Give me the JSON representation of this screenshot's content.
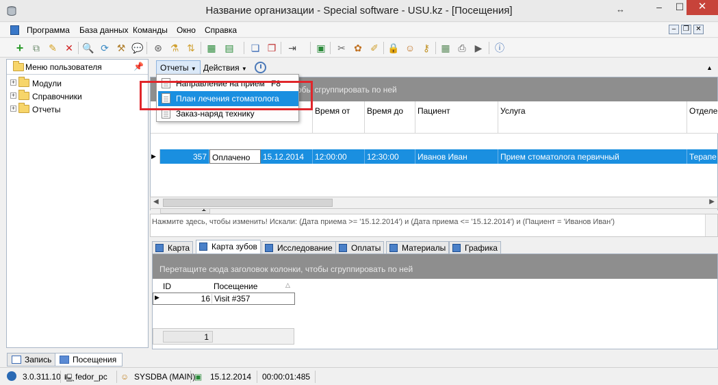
{
  "window": {
    "title": "Название организации - Special software - USU.kz - [Посещения]",
    "controls": {
      "min": "–",
      "max": "☐",
      "close": "✕",
      "resize": "↔"
    }
  },
  "menubar": {
    "items": [
      "Программа",
      "База данных",
      "Команды",
      "Окно",
      "Справка"
    ],
    "mdi": {
      "min": "–",
      "restore": "❐",
      "close": "✕"
    }
  },
  "toolbar": {
    "icons": [
      "add-icon",
      "copy-icon",
      "edit-icon",
      "delete-icon",
      "search-icon",
      "refresh-icon",
      "tools-icon",
      "chat-icon",
      "binoculars-icon",
      "filter-icon",
      "sort-icon",
      "export-excel-icon",
      "import-icon",
      "new-window-icon",
      "close-window-icon",
      "exit-icon",
      "calendar-icon",
      "tools2-icon",
      "paint-icon",
      "note-icon",
      "lock-icon",
      "users-icon",
      "keys-icon",
      "grid-icon",
      "print-icon",
      "play-icon",
      "info-icon"
    ]
  },
  "left_panel": {
    "title": "Меню пользователя",
    "items": [
      "Модули",
      "Справочники",
      "Отчеты"
    ]
  },
  "subtoolbar": {
    "reports_label": "Отчеты",
    "actions_label": "Действия"
  },
  "grid1": {
    "group_hint": "обы сгруппировать по ней",
    "columns": [
      "Время от",
      "Время до",
      "Пациент",
      "Услуга",
      "Отделе"
    ],
    "row": {
      "id": "357",
      "status": "Оплачено",
      "date": "15.12.2014",
      "time_from": "12:00:00",
      "time_to": "12:30:00",
      "patient": "Иванов Иван",
      "service": "Прием стоматолога первичный",
      "dept": "Терапе"
    },
    "footer_count": "1"
  },
  "filter_text": "Нажмите здесь, чтобы изменить! Искали: (Дата приема  >= '15.12.2014') и (Дата приема  <= '15.12.2014') и (Пациент = 'Иванов Иван')",
  "detail_tabs": [
    "Карта",
    "Карта зубов",
    "Исследование",
    "Оплаты",
    "Материалы",
    "Графика"
  ],
  "grid2": {
    "group_hint": "Перетащите сюда заголовок колонки, чтобы сгруппировать по ней",
    "columns": [
      "ID",
      "Посещение"
    ],
    "row": {
      "id": "16",
      "visit": "Visit #357"
    },
    "footer_count": "1"
  },
  "reports_menu": {
    "items": [
      {
        "label": "Направление на прием",
        "shortcut": "F8"
      },
      {
        "label": "План лечения стоматолога",
        "shortcut": ""
      },
      {
        "label": "Заказ-наряд технику",
        "shortcut": ""
      }
    ]
  },
  "bottom_tabs": [
    "Запись",
    "Посещения"
  ],
  "status": {
    "version": "3.0.311.10",
    "computer": "fedor_pc",
    "user": "SYSDBA (MAIN)",
    "date": "15.12.2014",
    "timer": "00:00:01:485"
  },
  "colors": {
    "selection": "#1a8fe0",
    "group_band": "#8e8e8e",
    "highlight_box": "#e0262b",
    "close_button": "#c7433a"
  }
}
